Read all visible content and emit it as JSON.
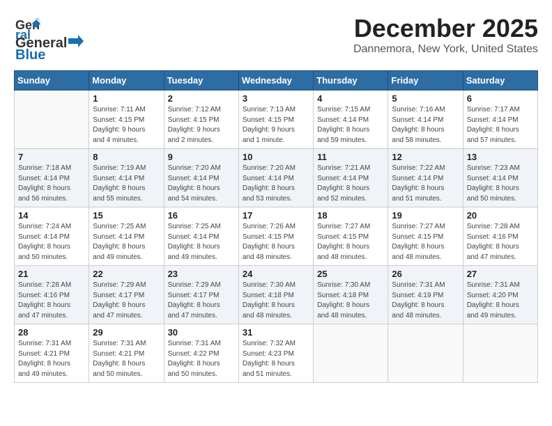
{
  "logo": {
    "line1": "General",
    "line2": "Blue"
  },
  "title": "December 2025",
  "location": "Dannemora, New York, United States",
  "days_of_week": [
    "Sunday",
    "Monday",
    "Tuesday",
    "Wednesday",
    "Thursday",
    "Friday",
    "Saturday"
  ],
  "weeks": [
    [
      {
        "day": "",
        "info": ""
      },
      {
        "day": "1",
        "info": "Sunrise: 7:11 AM\nSunset: 4:15 PM\nDaylight: 9 hours\nand 4 minutes."
      },
      {
        "day": "2",
        "info": "Sunrise: 7:12 AM\nSunset: 4:15 PM\nDaylight: 9 hours\nand 2 minutes."
      },
      {
        "day": "3",
        "info": "Sunrise: 7:13 AM\nSunset: 4:15 PM\nDaylight: 9 hours\nand 1 minute."
      },
      {
        "day": "4",
        "info": "Sunrise: 7:15 AM\nSunset: 4:14 PM\nDaylight: 8 hours\nand 59 minutes."
      },
      {
        "day": "5",
        "info": "Sunrise: 7:16 AM\nSunset: 4:14 PM\nDaylight: 8 hours\nand 58 minutes."
      },
      {
        "day": "6",
        "info": "Sunrise: 7:17 AM\nSunset: 4:14 PM\nDaylight: 8 hours\nand 57 minutes."
      }
    ],
    [
      {
        "day": "7",
        "info": "Sunrise: 7:18 AM\nSunset: 4:14 PM\nDaylight: 8 hours\nand 56 minutes."
      },
      {
        "day": "8",
        "info": "Sunrise: 7:19 AM\nSunset: 4:14 PM\nDaylight: 8 hours\nand 55 minutes."
      },
      {
        "day": "9",
        "info": "Sunrise: 7:20 AM\nSunset: 4:14 PM\nDaylight: 8 hours\nand 54 minutes."
      },
      {
        "day": "10",
        "info": "Sunrise: 7:20 AM\nSunset: 4:14 PM\nDaylight: 8 hours\nand 53 minutes."
      },
      {
        "day": "11",
        "info": "Sunrise: 7:21 AM\nSunset: 4:14 PM\nDaylight: 8 hours\nand 52 minutes."
      },
      {
        "day": "12",
        "info": "Sunrise: 7:22 AM\nSunset: 4:14 PM\nDaylight: 8 hours\nand 51 minutes."
      },
      {
        "day": "13",
        "info": "Sunrise: 7:23 AM\nSunset: 4:14 PM\nDaylight: 8 hours\nand 50 minutes."
      }
    ],
    [
      {
        "day": "14",
        "info": "Sunrise: 7:24 AM\nSunset: 4:14 PM\nDaylight: 8 hours\nand 50 minutes."
      },
      {
        "day": "15",
        "info": "Sunrise: 7:25 AM\nSunset: 4:14 PM\nDaylight: 8 hours\nand 49 minutes."
      },
      {
        "day": "16",
        "info": "Sunrise: 7:25 AM\nSunset: 4:14 PM\nDaylight: 8 hours\nand 49 minutes."
      },
      {
        "day": "17",
        "info": "Sunrise: 7:26 AM\nSunset: 4:15 PM\nDaylight: 8 hours\nand 48 minutes."
      },
      {
        "day": "18",
        "info": "Sunrise: 7:27 AM\nSunset: 4:15 PM\nDaylight: 8 hours\nand 48 minutes."
      },
      {
        "day": "19",
        "info": "Sunrise: 7:27 AM\nSunset: 4:15 PM\nDaylight: 8 hours\nand 48 minutes."
      },
      {
        "day": "20",
        "info": "Sunrise: 7:28 AM\nSunset: 4:16 PM\nDaylight: 8 hours\nand 47 minutes."
      }
    ],
    [
      {
        "day": "21",
        "info": "Sunrise: 7:28 AM\nSunset: 4:16 PM\nDaylight: 8 hours\nand 47 minutes."
      },
      {
        "day": "22",
        "info": "Sunrise: 7:29 AM\nSunset: 4:17 PM\nDaylight: 8 hours\nand 47 minutes."
      },
      {
        "day": "23",
        "info": "Sunrise: 7:29 AM\nSunset: 4:17 PM\nDaylight: 8 hours\nand 47 minutes."
      },
      {
        "day": "24",
        "info": "Sunrise: 7:30 AM\nSunset: 4:18 PM\nDaylight: 8 hours\nand 48 minutes."
      },
      {
        "day": "25",
        "info": "Sunrise: 7:30 AM\nSunset: 4:18 PM\nDaylight: 8 hours\nand 48 minutes."
      },
      {
        "day": "26",
        "info": "Sunrise: 7:31 AM\nSunset: 4:19 PM\nDaylight: 8 hours\nand 48 minutes."
      },
      {
        "day": "27",
        "info": "Sunrise: 7:31 AM\nSunset: 4:20 PM\nDaylight: 8 hours\nand 49 minutes."
      }
    ],
    [
      {
        "day": "28",
        "info": "Sunrise: 7:31 AM\nSunset: 4:21 PM\nDaylight: 8 hours\nand 49 minutes."
      },
      {
        "day": "29",
        "info": "Sunrise: 7:31 AM\nSunset: 4:21 PM\nDaylight: 8 hours\nand 50 minutes."
      },
      {
        "day": "30",
        "info": "Sunrise: 7:31 AM\nSunset: 4:22 PM\nDaylight: 8 hours\nand 50 minutes."
      },
      {
        "day": "31",
        "info": "Sunrise: 7:32 AM\nSunset: 4:23 PM\nDaylight: 8 hours\nand 51 minutes."
      },
      {
        "day": "",
        "info": ""
      },
      {
        "day": "",
        "info": ""
      },
      {
        "day": "",
        "info": ""
      }
    ]
  ]
}
